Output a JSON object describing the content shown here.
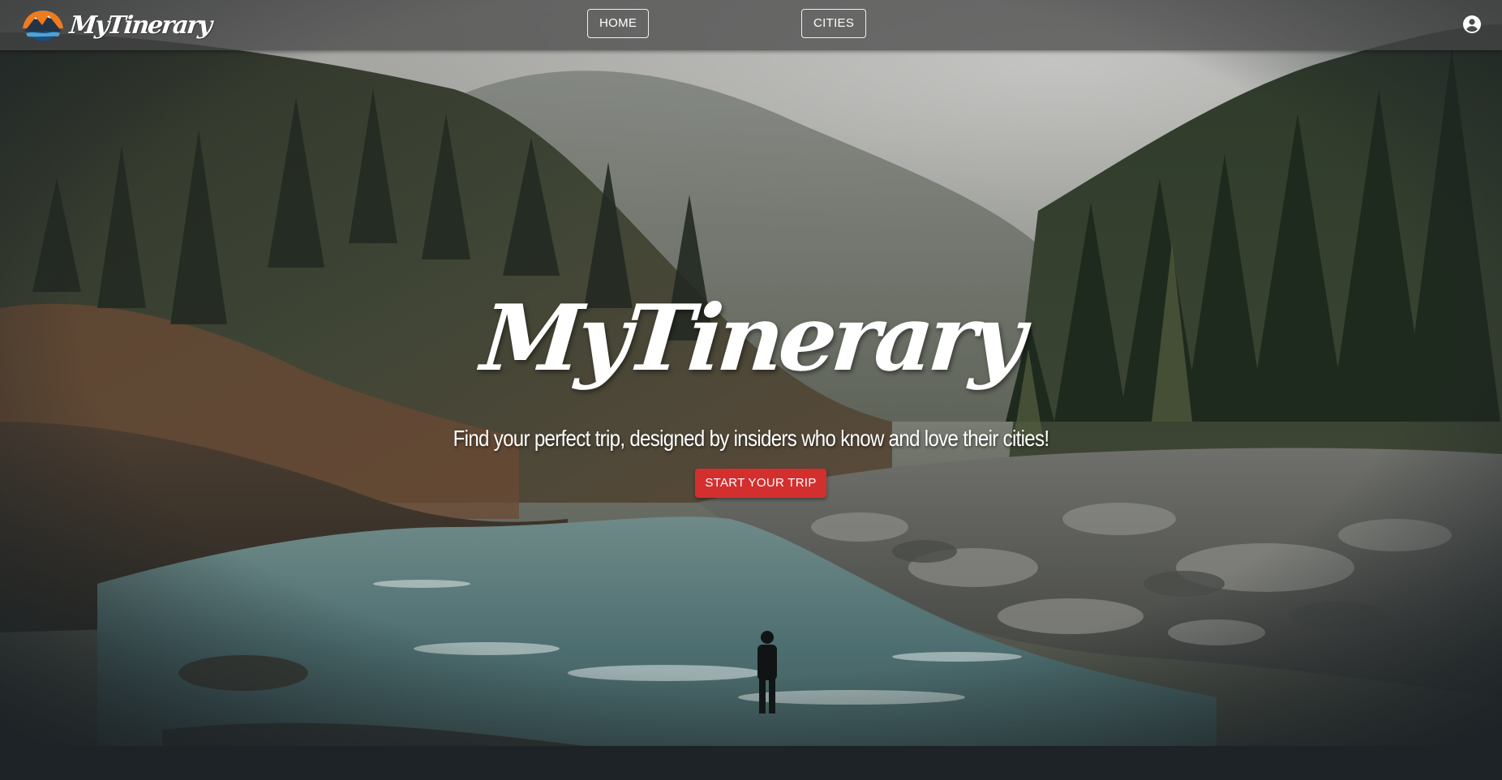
{
  "navbar": {
    "brand_text": "MyTinerary",
    "home_label": "HOME",
    "cities_label": "CITIES",
    "account_icon": "account-circle-icon"
  },
  "hero": {
    "title": "MyTinerary",
    "tagline": "Find your perfect trip, designed by insiders who know and love their cities!",
    "cta_label": "START YOUR TRIP"
  },
  "colors": {
    "cta": "#d32f2f",
    "navbar": "#464646",
    "text": "#ffffff",
    "backdrop": "#1d2326"
  }
}
